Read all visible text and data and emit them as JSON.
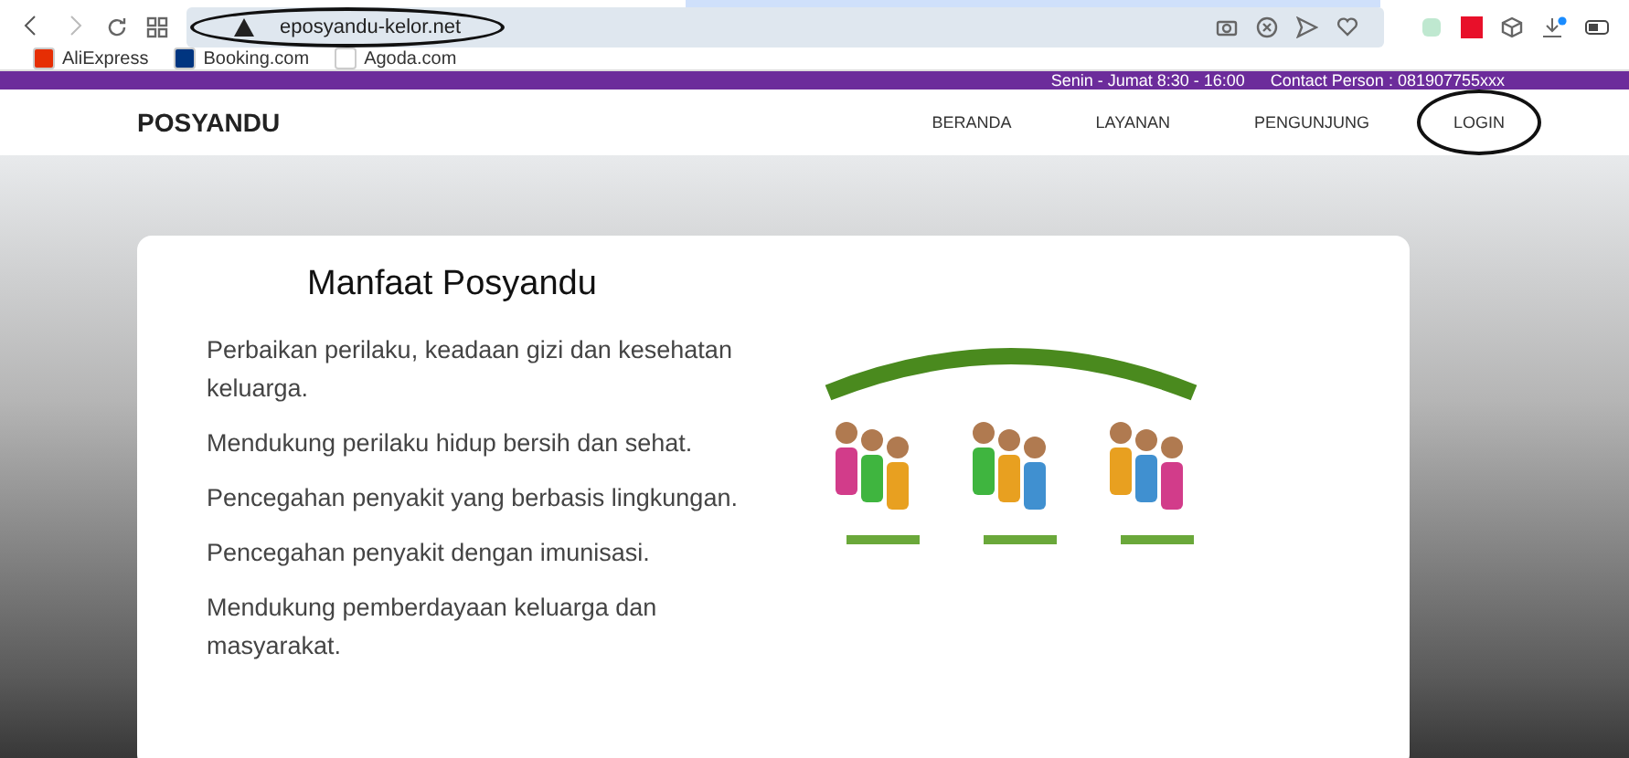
{
  "browser": {
    "url": "eposyandu-kelor.net",
    "bookmarks": [
      {
        "label": "AliExpress",
        "color": "#e62e04"
      },
      {
        "label": "Booking.com",
        "color": "#003580"
      },
      {
        "label": "Agoda.com",
        "color": "#ffffff"
      }
    ]
  },
  "topbar": {
    "hours": "Senin - Jumat 8:30 - 16:00",
    "contact": "Contact Person : 081907755xxx"
  },
  "navbar": {
    "brand": "POSYANDU",
    "links": [
      {
        "label": "BERANDA",
        "circled": false
      },
      {
        "label": "LAYANAN",
        "circled": false
      },
      {
        "label": "PENGUNJUNG",
        "circled": false
      },
      {
        "label": "LOGIN",
        "circled": true
      }
    ]
  },
  "card": {
    "title": "Manfaat Posyandu",
    "items": [
      "Perbaikan perilaku, keadaan gizi dan kesehatan keluarga.",
      "Mendukung perilaku hidup bersih dan sehat.",
      "Pencegahan penyakit yang berbasis lingkungan.",
      "Pencegahan penyakit dengan imunisasi.",
      "Mendukung pemberdayaan keluarga dan masyarakat."
    ]
  }
}
